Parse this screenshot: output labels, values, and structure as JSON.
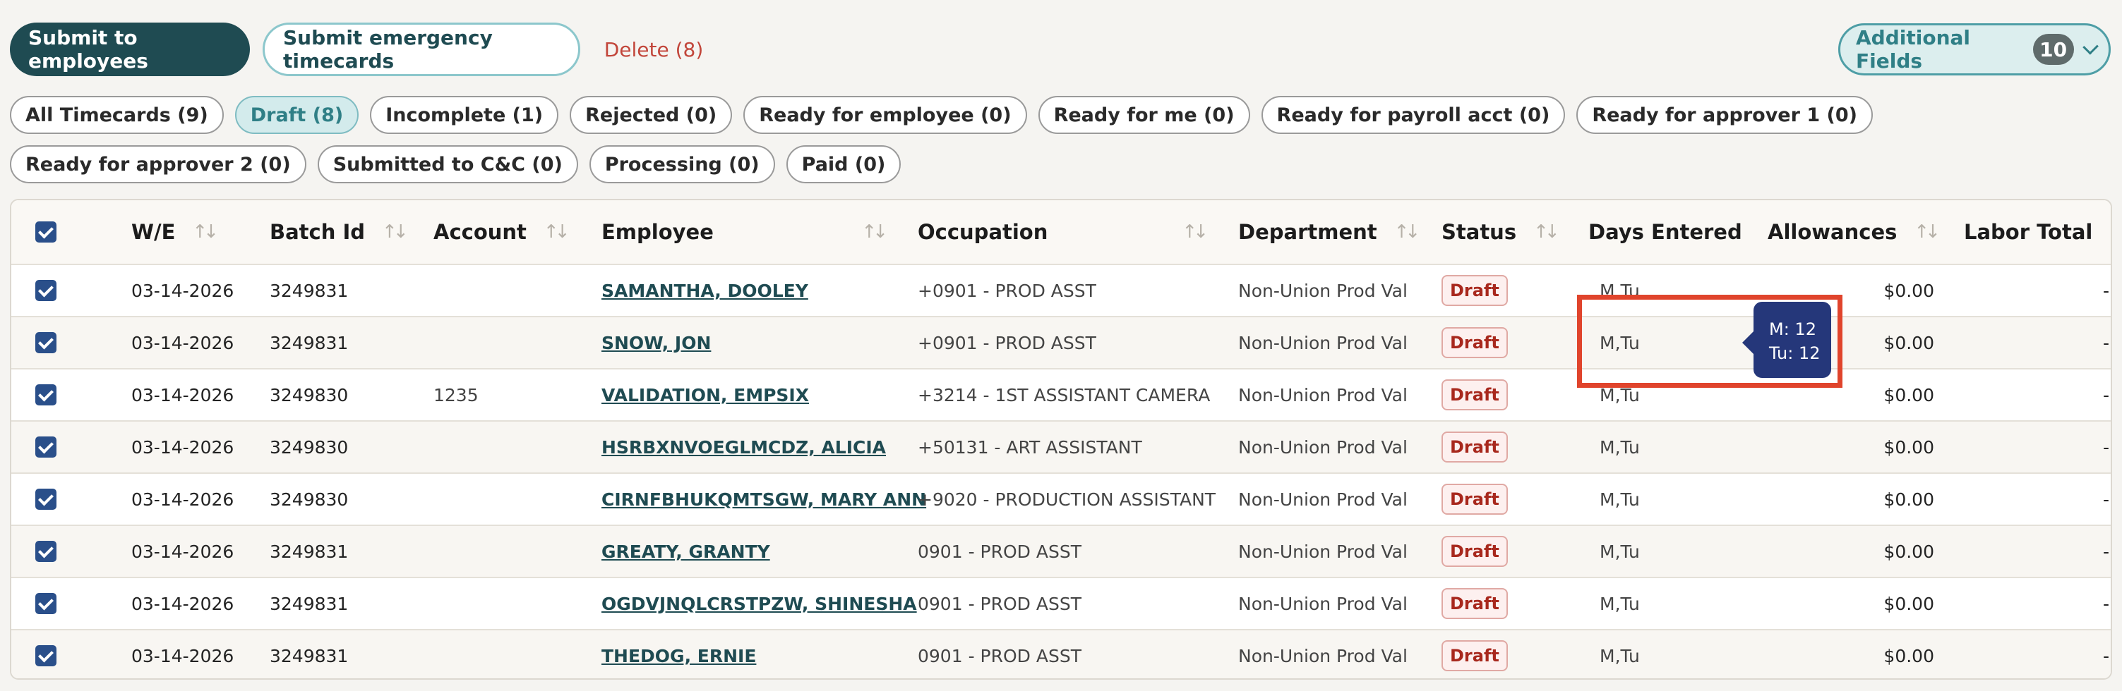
{
  "actions": {
    "submit_employees": "Submit to employees",
    "submit_emergency": "Submit emergency timecards",
    "delete": "Delete (8)",
    "additional_fields": "Additional Fields",
    "additional_count": "10"
  },
  "filters": [
    {
      "label": "All Timecards (9)"
    },
    {
      "label": "Draft (8)",
      "active": true
    },
    {
      "label": "Incomplete (1)"
    },
    {
      "label": "Rejected (0)"
    },
    {
      "label": "Ready for employee (0)"
    },
    {
      "label": "Ready for me (0)"
    },
    {
      "label": "Ready for payroll acct (0)"
    },
    {
      "label": "Ready for approver 1 (0)"
    },
    {
      "label": "Ready for approver 2 (0)"
    },
    {
      "label": "Submitted to C&C (0)"
    },
    {
      "label": "Processing (0)"
    },
    {
      "label": "Paid (0)"
    }
  ],
  "table": {
    "headers": {
      "we": "W/E",
      "batch": "Batch Id",
      "account": "Account",
      "employee": "Employee",
      "occupation": "Occupation",
      "department": "Department",
      "status": "Status",
      "days": "Days Entered",
      "allowances": "Allowances",
      "labor": "Labor Total"
    },
    "rows": [
      {
        "we": "03-14-2026",
        "batch": "3249831",
        "account": "",
        "employee": "SAMANTHA, DOOLEY",
        "occupation": "+0901 - PROD ASST",
        "department": "Non-Union Prod Val",
        "status": "Draft",
        "days": "M,Tu",
        "allowances": "$0.00",
        "labor": "-"
      },
      {
        "we": "03-14-2026",
        "batch": "3249831",
        "account": "",
        "employee": "SNOW, JON",
        "occupation": "+0901 - PROD ASST",
        "department": "Non-Union Prod Val",
        "status": "Draft",
        "days": "M,Tu",
        "allowances": "$0.00",
        "labor": "-"
      },
      {
        "we": "03-14-2026",
        "batch": "3249830",
        "account": "1235",
        "employee": "VALIDATION, EMPSIX",
        "occupation": "+3214 - 1ST ASSISTANT CAMERA",
        "department": "Non-Union Prod Val",
        "status": "Draft",
        "days": "M,Tu",
        "allowances": "$0.00",
        "labor": "-"
      },
      {
        "we": "03-14-2026",
        "batch": "3249830",
        "account": "",
        "employee": "HSRBXNVOEGLMCDZ, ALICIA",
        "occupation": "+50131 - ART ASSISTANT",
        "department": "Non-Union Prod Val",
        "status": "Draft",
        "days": "M,Tu",
        "allowances": "$0.00",
        "labor": "-"
      },
      {
        "we": "03-14-2026",
        "batch": "3249830",
        "account": "",
        "employee": "CIRNFBHUKQMTSGW, MARY ANN",
        "occupation": "+9020 - PRODUCTION ASSISTANT",
        "department": "Non-Union Prod Val",
        "status": "Draft",
        "days": "M,Tu",
        "allowances": "$0.00",
        "labor": "-"
      },
      {
        "we": "03-14-2026",
        "batch": "3249831",
        "account": "",
        "employee": "GREATY, GRANTY",
        "occupation": "0901 - PROD ASST",
        "department": "Non-Union Prod Val",
        "status": "Draft",
        "days": "M,Tu",
        "allowances": "$0.00",
        "labor": "-"
      },
      {
        "we": "03-14-2026",
        "batch": "3249831",
        "account": "",
        "employee": "OGDVJNQLCRSTPZW, SHINESHA",
        "occupation": "0901 - PROD ASST",
        "department": "Non-Union Prod Val",
        "status": "Draft",
        "days": "M,Tu",
        "allowances": "$0.00",
        "labor": "-"
      },
      {
        "we": "03-14-2026",
        "batch": "3249831",
        "account": "",
        "employee": "THEDOG, ERNIE",
        "occupation": "0901 - PROD ASST",
        "department": "Non-Union Prod Val",
        "status": "Draft",
        "days": "M,Tu",
        "allowances": "$0.00",
        "labor": "-"
      }
    ]
  },
  "tooltip": {
    "line1": "M: 12",
    "line2": "Tu: 12"
  },
  "colors": {
    "primary": "#1f4b52",
    "accent": "#4e9ea6",
    "danger": "#c2463b",
    "checkbox": "#2a4f8a",
    "highlight": "#e0442c",
    "tooltip": "#25377a"
  }
}
